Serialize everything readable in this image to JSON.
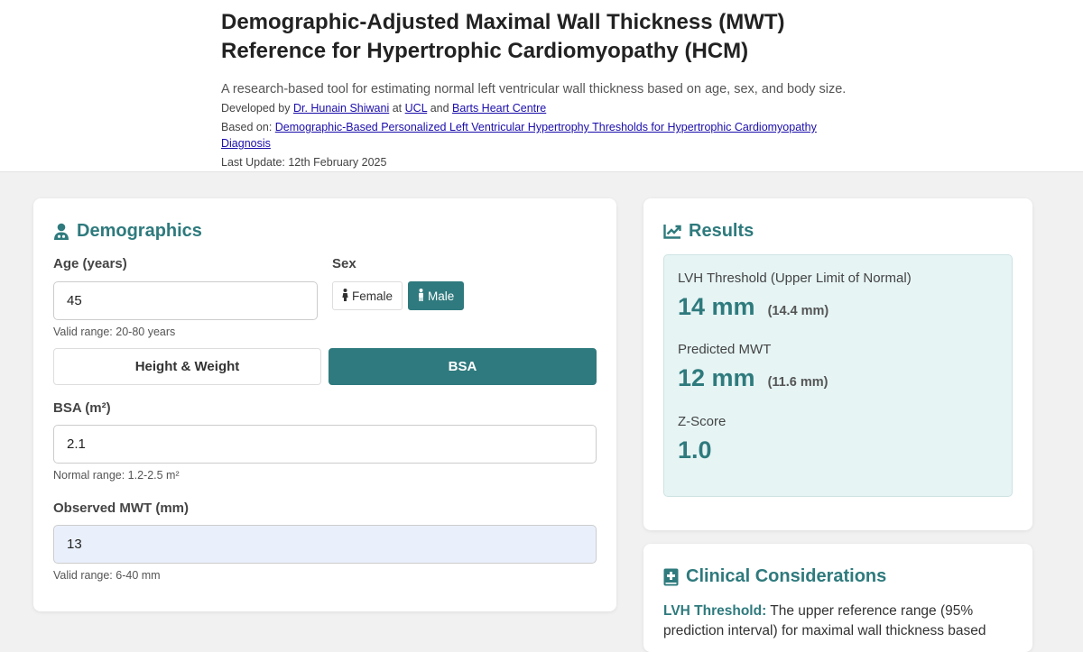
{
  "header": {
    "title_line1": "Demographic-Adjusted Maximal Wall Thickness (MWT)",
    "title_line2": "Reference for Hypertrophic Cardiomyopathy (HCM)",
    "subtitle": "A research-based tool for estimating normal left ventricular wall thickness based on age, sex, and body size.",
    "developed_prefix": "Developed by",
    "developer": "Dr. Hunain Shiwani",
    "at_word": "at",
    "institution1": "UCL",
    "and_word": "and",
    "institution2": "Barts Heart Centre",
    "based_on_prefix": "Based on:",
    "based_on_link": "Demographic-Based Personalized Left Ventricular Hypertrophy Thresholds for Hypertrophic Cardiomyopathy Diagnosis",
    "last_update": "Last Update: 12th February 2025"
  },
  "demographics": {
    "heading": "Demographics",
    "age_label": "Age (years)",
    "age_value": "45",
    "age_hint": "Valid range: 20-80 years",
    "sex_label": "Sex",
    "sex_female": "Female",
    "sex_male": "Male",
    "selected_sex": "Male",
    "toggle_height_weight": "Height & Weight",
    "toggle_bsa": "BSA",
    "selected_toggle": "BSA",
    "bsa_label": "BSA (m²)",
    "bsa_value": "2.1",
    "bsa_hint": "Normal range: 1.2-2.5 m²",
    "mwt_label": "Observed MWT (mm)",
    "mwt_value": "13",
    "mwt_hint": "Valid range: 6-40 mm"
  },
  "results": {
    "heading": "Results",
    "lvh_label": "LVH Threshold (Upper Limit of Normal)",
    "lvh_value": "14 mm",
    "lvh_exact": "(14.4 mm)",
    "pred_label": "Predicted MWT",
    "pred_value": "12 mm",
    "pred_exact": "(11.6 mm)",
    "z_label": "Z-Score",
    "z_value": "1.0"
  },
  "clinical": {
    "heading": "Clinical Considerations",
    "term": "LVH Threshold:",
    "text": "The upper reference range (95% prediction interval) for maximal wall thickness based"
  },
  "colors": {
    "accent": "#2e7a7d",
    "results_bg": "#e6f4f4",
    "mwt_input_bg": "#eaf0fb",
    "page_bg": "#f1f1f1"
  }
}
